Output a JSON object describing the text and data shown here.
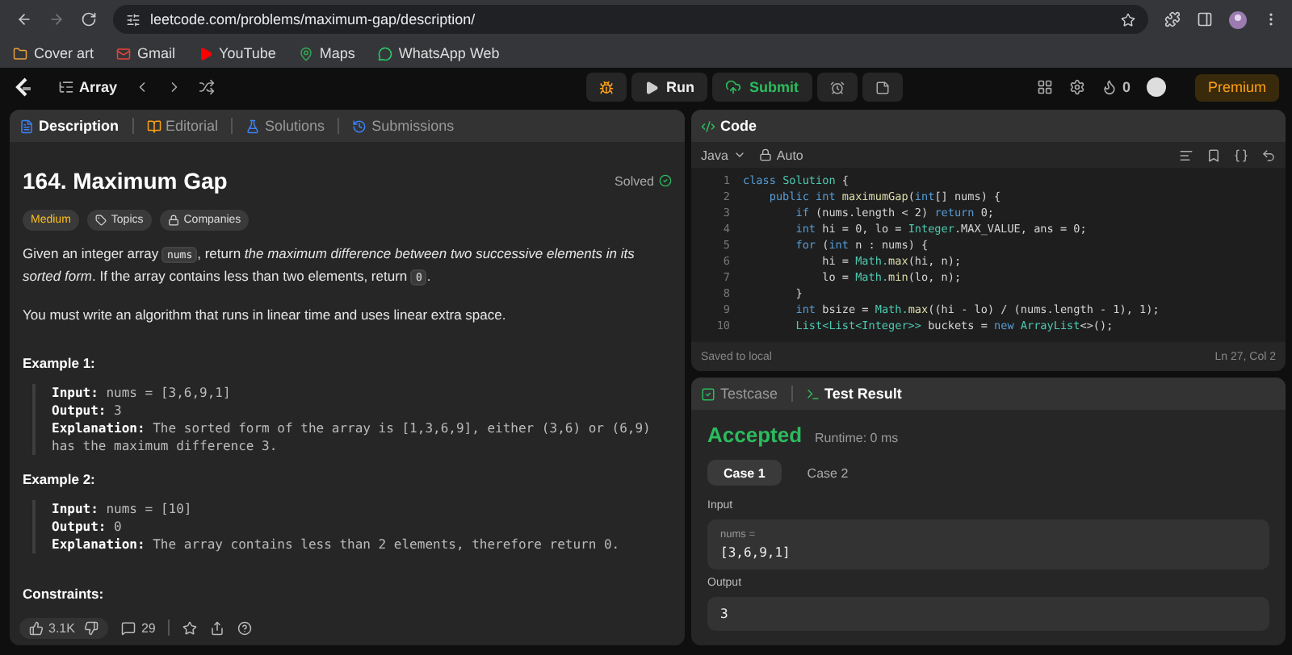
{
  "browser": {
    "url": "leetcode.com/problems/maximum-gap/description/",
    "bookmarks": [
      {
        "label": "Cover art",
        "kind": "folder"
      },
      {
        "label": "Gmail",
        "kind": "mail"
      },
      {
        "label": "YouTube",
        "kind": "video"
      },
      {
        "label": "Maps",
        "kind": "pin"
      },
      {
        "label": "WhatsApp Web",
        "kind": "chat"
      }
    ]
  },
  "header": {
    "list_label": "Array",
    "run": "Run",
    "submit": "Submit",
    "streak": "0",
    "premium": "Premium"
  },
  "left_tabs": [
    {
      "label": "Description",
      "selected": true,
      "kind": "doc"
    },
    {
      "label": "Editorial",
      "selected": false,
      "kind": "book"
    },
    {
      "label": "Solutions",
      "selected": false,
      "kind": "flask"
    },
    {
      "label": "Submissions",
      "selected": false,
      "kind": "history"
    }
  ],
  "problem": {
    "title": "164. Maximum Gap",
    "status": "Solved",
    "tags": [
      {
        "label": "Medium",
        "kind": "difficulty"
      },
      {
        "label": "Topics",
        "kind": "tag"
      },
      {
        "label": "Companies",
        "kind": "lock"
      }
    ],
    "paragraphs": [
      [
        {
          "kind": "text",
          "text": "Given an integer array "
        },
        {
          "kind": "code",
          "text": "nums"
        },
        {
          "kind": "text",
          "text": ", return *the maximum difference between two successive elements in its sorted form*. If the array contains less than two elements, return "
        },
        {
          "kind": "code",
          "text": "0"
        },
        {
          "kind": "text",
          "text": "."
        }
      ],
      [
        {
          "kind": "text",
          "text": "You must write an algorithm that runs in linear time and uses linear extra space."
        }
      ]
    ],
    "examples": [
      {
        "title": "Example 1:",
        "lines": [
          "**Input:** nums = [3,6,9,1]",
          "**Output:** 3",
          "**Explanation:** The sorted form of the array is [1,3,6,9], either (3,6) or (6,9) has the maximum difference 3."
        ]
      },
      {
        "title": "Example 2:",
        "lines": [
          "**Input:** nums = [10]",
          "**Output:** 0",
          "**Explanation:** The array contains less than 2 elements, therefore return 0."
        ]
      }
    ],
    "constraints_title": "Constraints:"
  },
  "footer": {
    "likes": "3.1K",
    "comments": "29"
  },
  "code": {
    "title": "Code",
    "language": "Java",
    "mode": "Auto",
    "lines": [
      {
        "number": "1",
        "segments": [
          {
            "kind": "kw",
            "text": "class "
          },
          {
            "kind": "type",
            "text": "Solution"
          },
          {
            "kind": "plain",
            "text": " {"
          }
        ]
      },
      {
        "number": "2",
        "segments": [
          {
            "kind": "kw",
            "text": "    public int "
          },
          {
            "kind": "fn",
            "text": "maximumGap"
          },
          {
            "kind": "plain",
            "text": "("
          },
          {
            "kind": "kw",
            "text": "int"
          },
          {
            "kind": "plain",
            "text": "[] nums) {"
          }
        ]
      },
      {
        "number": "3",
        "segments": [
          {
            "kind": "kw",
            "text": "        if "
          },
          {
            "kind": "plain",
            "text": "(nums.length < 2) "
          },
          {
            "kind": "kw",
            "text": "return "
          },
          {
            "kind": "plain",
            "text": "0;"
          }
        ]
      },
      {
        "number": "4",
        "segments": [
          {
            "kind": "kw",
            "text": "        int "
          },
          {
            "kind": "plain",
            "text": "hi = 0, lo = "
          },
          {
            "kind": "type",
            "text": "Integer"
          },
          {
            "kind": "plain",
            "text": ".MAX_VALUE, ans = 0;"
          }
        ]
      },
      {
        "number": "5",
        "segments": [
          {
            "kind": "kw",
            "text": "        for "
          },
          {
            "kind": "plain",
            "text": "("
          },
          {
            "kind": "kw",
            "text": "int "
          },
          {
            "kind": "plain",
            "text": "n : nums) {"
          }
        ]
      },
      {
        "number": "6",
        "segments": [
          {
            "kind": "plain",
            "text": "            hi = "
          },
          {
            "kind": "type",
            "text": "Math."
          },
          {
            "kind": "fn",
            "text": "max"
          },
          {
            "kind": "plain",
            "text": "(hi, n);"
          }
        ]
      },
      {
        "number": "7",
        "segments": [
          {
            "kind": "plain",
            "text": "            lo = "
          },
          {
            "kind": "type",
            "text": "Math."
          },
          {
            "kind": "fn",
            "text": "min"
          },
          {
            "kind": "plain",
            "text": "(lo, n);"
          }
        ]
      },
      {
        "number": "8",
        "segments": [
          {
            "kind": "plain",
            "text": "        }"
          }
        ]
      },
      {
        "number": "9",
        "segments": [
          {
            "kind": "kw",
            "text": "        int "
          },
          {
            "kind": "plain",
            "text": "bsize = "
          },
          {
            "kind": "type",
            "text": "Math."
          },
          {
            "kind": "fn",
            "text": "max"
          },
          {
            "kind": "plain",
            "text": "((hi - lo) / (nums.length - 1), 1);"
          }
        ]
      },
      {
        "number": "10",
        "segments": [
          {
            "kind": "type",
            "text": "        List<List<Integer>>"
          },
          {
            "kind": "plain",
            "text": " buckets = "
          },
          {
            "kind": "kw",
            "text": "new "
          },
          {
            "kind": "type",
            "text": "ArrayList"
          },
          {
            "kind": "plain",
            "text": "<>();"
          }
        ]
      }
    ],
    "saved": "Saved to local",
    "cursor": "Ln 27, Col 2"
  },
  "result_tabs": [
    {
      "label": "Testcase",
      "selected": false,
      "kind": "check"
    },
    {
      "label": "Test Result",
      "selected": true,
      "kind": "terminal"
    }
  ],
  "result": {
    "verdict": "Accepted",
    "runtime": "Runtime: 0 ms",
    "cases": [
      {
        "label": "Case 1",
        "selected": true
      },
      {
        "label": "Case 2",
        "selected": false
      }
    ],
    "input_label": "Input",
    "input_name": "nums =",
    "input_value": "[3,6,9,1]",
    "output_label": "Output",
    "output_value": "3"
  }
}
